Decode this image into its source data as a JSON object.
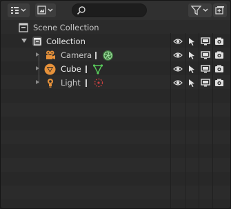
{
  "header": {
    "display_mode_icon": "outliner-display-icon",
    "filter_icon": "filter-icon",
    "search": {
      "placeholder": "",
      "value": ""
    }
  },
  "tree": [
    {
      "label": "Scene Collection",
      "icon": "scene-collection-icon",
      "level": 0,
      "expanded": true
    },
    {
      "label": "Collection",
      "icon": "collection-icon",
      "level": 1,
      "expanded": true
    },
    {
      "label": "Camera",
      "icon": "camera-object-icon",
      "data_icon": "camera-data-icon",
      "level": 2,
      "expanded": false
    },
    {
      "label": "Cube",
      "icon": "mesh-object-icon",
      "data_icon": "mesh-data-icon",
      "level": 2,
      "expanded": false
    },
    {
      "label": "Light",
      "icon": "light-object-icon",
      "data_icon": "light-data-icon",
      "level": 2,
      "expanded": false
    }
  ],
  "restriction_columns": [
    "visibility-eye-icon",
    "select-arrow-icon",
    "viewport-monitor-icon",
    "render-camera-icon"
  ],
  "colors": {
    "object_orange": "#e6913a",
    "camera_data_green": "#5cb85c",
    "mesh_data_green": "#58c85a",
    "light_data_red": "#c84040",
    "collection_white": "#e8e8e8"
  }
}
